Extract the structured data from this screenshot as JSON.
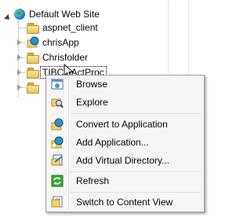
{
  "tree": {
    "root": {
      "label": "Default Web Site",
      "icon": "globe-icon"
    },
    "children": [
      {
        "label": "aspnet_client",
        "icon": "folder-icon",
        "name": "tree-item-aspnet-client"
      },
      {
        "label": "chrisApp",
        "icon": "application-icon",
        "name": "tree-item-chrisapp"
      },
      {
        "label": "Chrisfolder",
        "icon": "folder-icon",
        "name": "tree-item-chrisfolder"
      },
      {
        "label": "TIBCOActProc",
        "icon": "folder-icon",
        "name": "tree-item-tibcoactproc",
        "selected": true
      },
      {
        "label": "",
        "icon": "folder-icon",
        "name": "tree-item-partial"
      }
    ]
  },
  "context_menu": {
    "items": [
      {
        "label": "Browse",
        "icon": "browse-icon"
      },
      {
        "label": "Explore",
        "icon": "explore-icon"
      },
      {
        "label": "Convert to Application",
        "icon": "convert-application-icon"
      },
      {
        "label": "Add Application...",
        "icon": "add-application-icon"
      },
      {
        "label": "Add Virtual Directory...",
        "icon": "add-virtual-directory-icon"
      },
      {
        "label": "Refresh",
        "icon": "refresh-icon"
      },
      {
        "label": "Switch to Content View",
        "icon": "content-view-icon"
      }
    ]
  },
  "colors": {
    "menu_background": "#f5f5f5",
    "menu_border": "#979797",
    "folder": "#f2d36e"
  }
}
